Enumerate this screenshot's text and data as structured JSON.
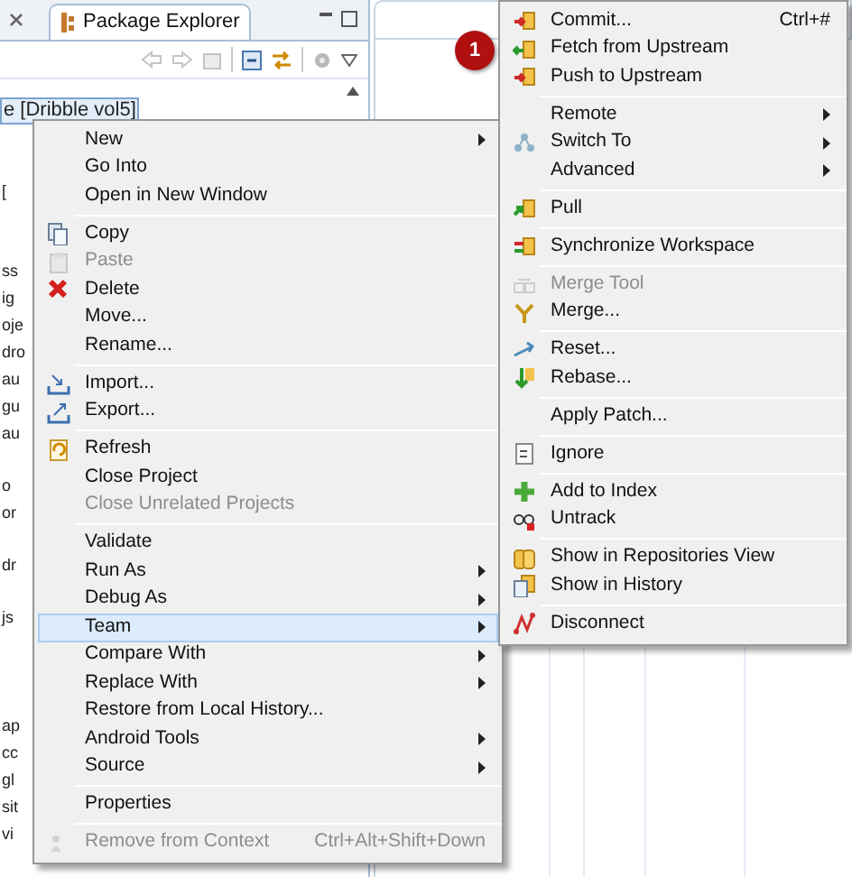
{
  "views": {
    "left_tab": {
      "title": "Package Explorer",
      "selected": true
    },
    "tree": [
      [
        {
          "label": "e [Dribble vol5]",
          "selected": true
        }
      ],
      [
        {
          "label": "[",
          "selected": false
        }
      ],
      [
        {
          "label": "ss",
          "selected": false
        },
        {
          "label": "ig",
          "selected": false
        },
        {
          "label": "oje",
          "selected": false
        },
        {
          "label": "dro",
          "selected": false
        },
        {
          "label": "au",
          "selected": false
        },
        {
          "label": "gu",
          "selected": false
        },
        {
          "label": "au",
          "selected": false
        }
      ],
      [
        {
          "label": "o",
          "selected": false
        },
        {
          "label": "or",
          "selected": false
        }
      ],
      [
        {
          "label": "dr",
          "selected": false
        }
      ],
      [
        {
          "label": "js",
          "selected": false
        }
      ],
      [
        {
          "label": "ap",
          "selected": false
        },
        {
          "label": "cc",
          "selected": false
        },
        {
          "label": "gl",
          "selected": false
        },
        {
          "label": "sit",
          "selected": false
        },
        {
          "label": "vi",
          "selected": false
        }
      ]
    ]
  },
  "context_menu": [
    [
      {
        "label": "New",
        "submenu": true
      },
      {
        "label": "Go Into"
      },
      {
        "label": "Open in New Window"
      }
    ],
    [
      {
        "label": "Copy",
        "kind": "copy"
      },
      {
        "label": "Paste",
        "kind": "paste",
        "disabled": true
      },
      {
        "label": "Delete",
        "kind": "delete"
      },
      {
        "label": "Move..."
      },
      {
        "label": "Rename..."
      }
    ],
    [
      {
        "label": "Import...",
        "kind": "import"
      },
      {
        "label": "Export...",
        "kind": "export"
      }
    ],
    [
      {
        "label": "Refresh",
        "kind": "refresh"
      },
      {
        "label": "Close Project"
      },
      {
        "label": "Close Unrelated Projects",
        "disabled": true
      }
    ],
    [
      {
        "label": "Validate"
      },
      {
        "label": "Run As",
        "submenu": true
      },
      {
        "label": "Debug As",
        "submenu": true
      },
      {
        "label": "Team",
        "submenu": true,
        "selected": true
      },
      {
        "label": "Compare With",
        "submenu": true
      },
      {
        "label": "Replace With",
        "submenu": true
      },
      {
        "label": "Restore from Local History..."
      },
      {
        "label": "Android Tools",
        "submenu": true
      },
      {
        "label": "Source",
        "submenu": true
      }
    ],
    [
      {
        "label": "Properties"
      }
    ],
    [
      {
        "label": "Remove from Context",
        "kind": "context",
        "disabled": true,
        "shortcut": "Ctrl+Alt+Shift+Down"
      }
    ]
  ],
  "team_submenu": [
    [
      {
        "label": "Commit...",
        "kind": "commit",
        "shortcut": "Ctrl+#"
      },
      {
        "label": "Fetch from Upstream",
        "kind": "fetch"
      },
      {
        "label": "Push to Upstream",
        "kind": "push"
      }
    ],
    [
      {
        "label": "Remote",
        "submenu": true
      },
      {
        "label": "Switch To",
        "kind": "switch",
        "submenu": true
      },
      {
        "label": "Advanced",
        "submenu": true
      }
    ],
    [
      {
        "label": "Pull",
        "kind": "pull"
      }
    ],
    [
      {
        "label": "Synchronize Workspace",
        "kind": "sync"
      }
    ],
    [
      {
        "label": "Merge Tool",
        "kind": "mergetool",
        "disabled": true
      },
      {
        "label": "Merge...",
        "kind": "merge"
      }
    ],
    [
      {
        "label": "Reset...",
        "kind": "reset"
      },
      {
        "label": "Rebase...",
        "kind": "rebase"
      }
    ],
    [
      {
        "label": "Apply Patch..."
      }
    ],
    [
      {
        "label": "Ignore",
        "kind": "ignore"
      }
    ],
    [
      {
        "label": "Add to Index",
        "kind": "add"
      },
      {
        "label": "Untrack",
        "kind": "untrack"
      }
    ],
    [
      {
        "label": "Show in Repositories View",
        "kind": "repos"
      },
      {
        "label": "Show in History",
        "kind": "history"
      }
    ],
    [
      {
        "label": "Disconnect",
        "kind": "disconnect"
      }
    ]
  ],
  "step_badge": "1"
}
